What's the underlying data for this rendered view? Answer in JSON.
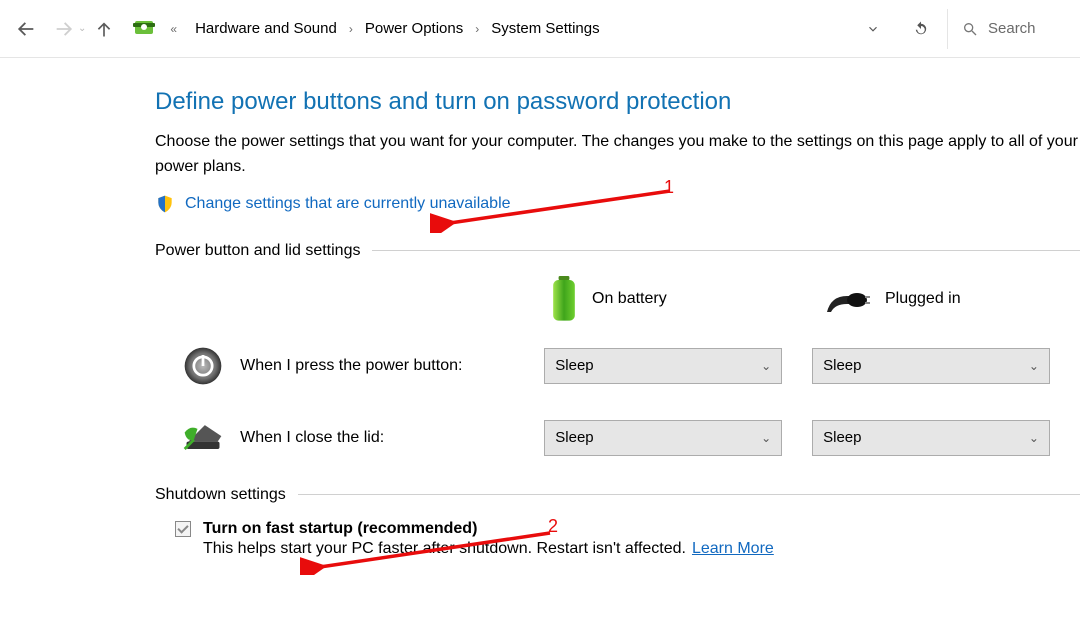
{
  "nav": {
    "breadcrumb": [
      "Hardware and Sound",
      "Power Options",
      "System Settings"
    ],
    "search_placeholder": "Search"
  },
  "page": {
    "title": "Define power buttons and turn on password protection",
    "description": "Choose the power settings that you want for your computer. The changes you make to the settings on this page apply to all of your power plans.",
    "change_link": "Change settings that are currently unavailable"
  },
  "sections": {
    "power_button_lid": {
      "heading": "Power button and lid settings",
      "col_battery": "On battery",
      "col_plugged": "Plugged in",
      "rows": [
        {
          "label": "When I press the power button:",
          "battery_value": "Sleep",
          "plugged_value": "Sleep"
        },
        {
          "label": "When I close the lid:",
          "battery_value": "Sleep",
          "plugged_value": "Sleep"
        }
      ]
    },
    "shutdown": {
      "heading": "Shutdown settings",
      "fast_startup": {
        "checked": true,
        "title": "Turn on fast startup (recommended)",
        "desc": "This helps start your PC faster after shutdown. Restart isn't affected.",
        "learn_more": "Learn More"
      }
    }
  },
  "annotations": {
    "a1": "1",
    "a2": "2"
  }
}
